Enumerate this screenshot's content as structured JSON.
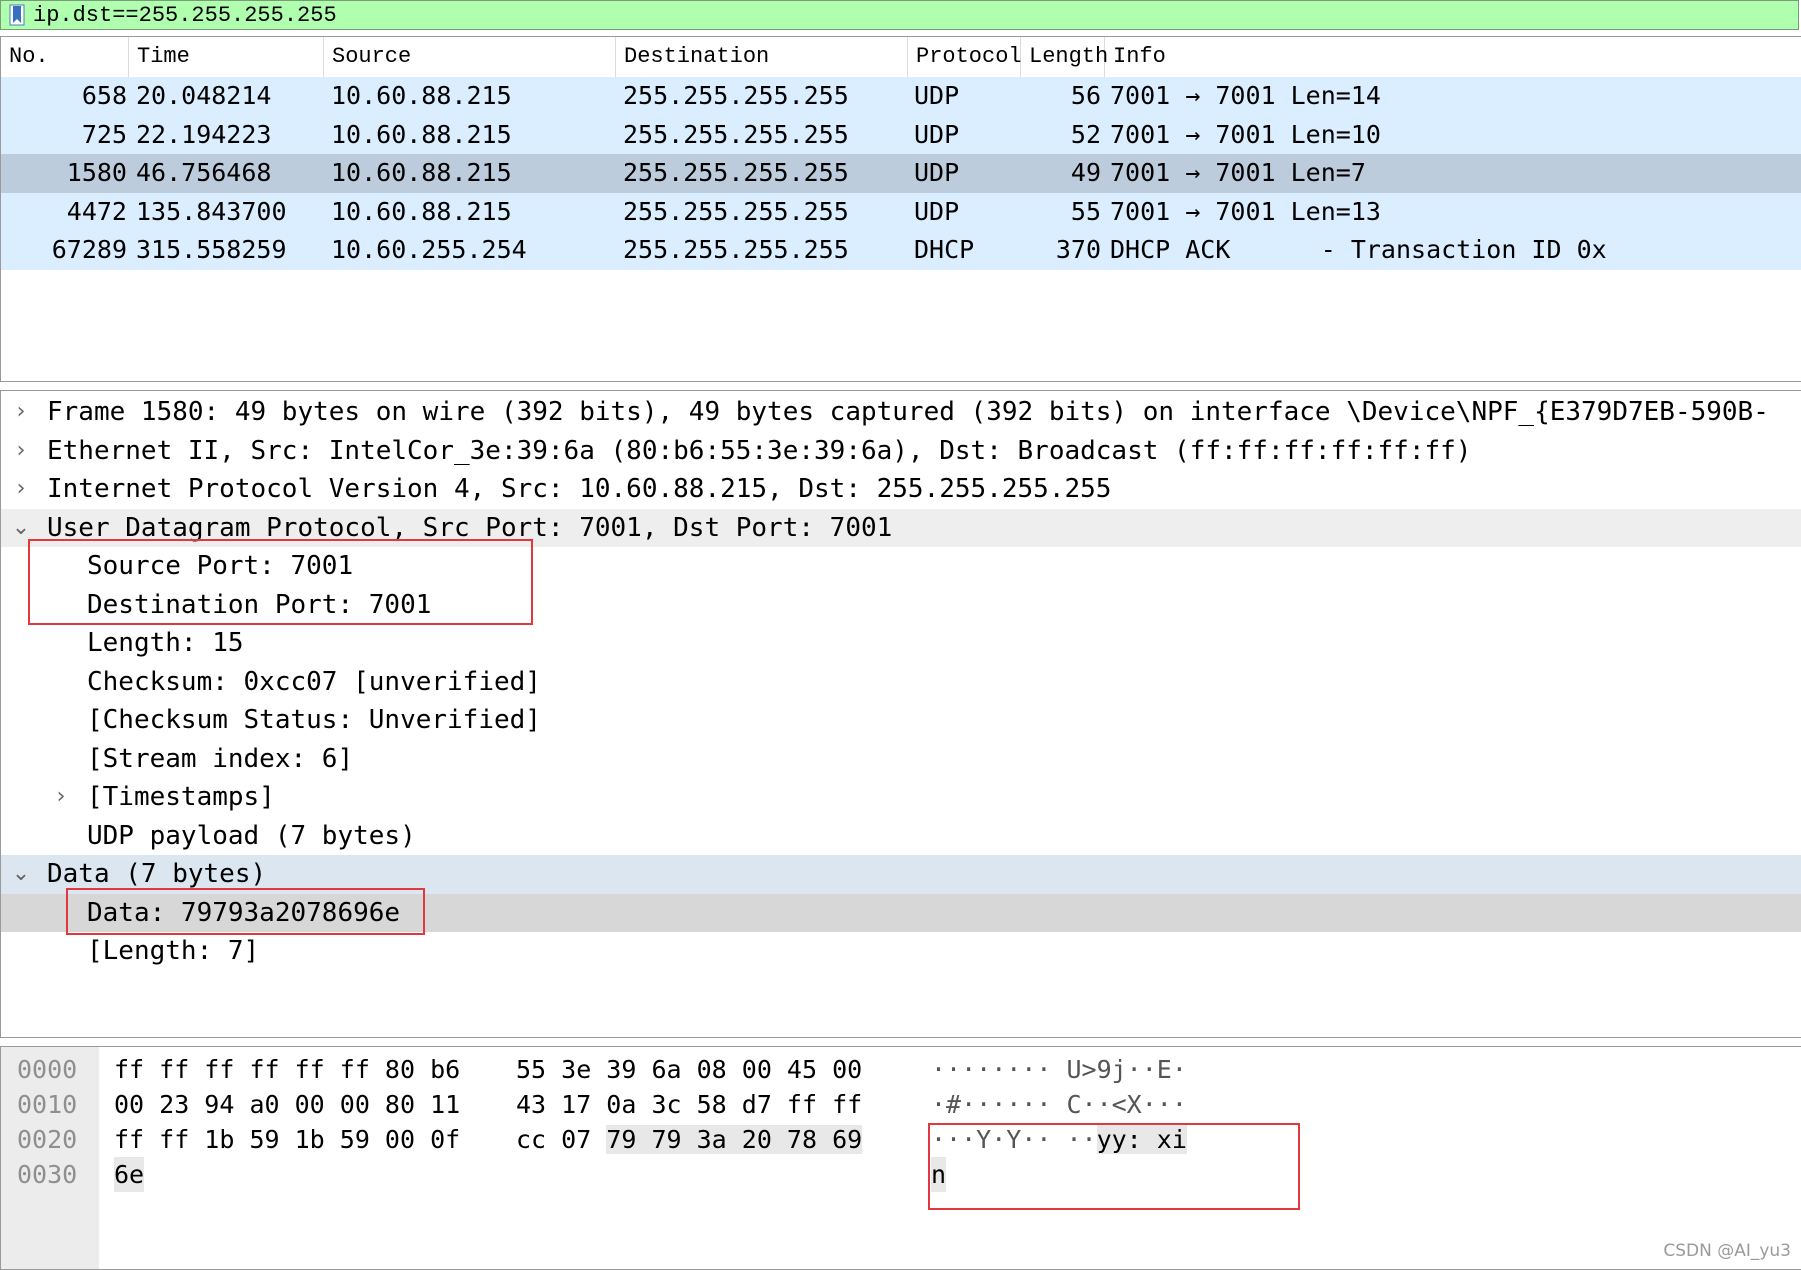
{
  "filter": {
    "text": "ip.dst==255.255.255.255"
  },
  "packet_list": {
    "columns": [
      "No.",
      "Time",
      "Source",
      "Destination",
      "Protocol",
      "Length",
      "Info"
    ],
    "rows": [
      {
        "no": "658",
        "time": "20.048214",
        "source": "10.60.88.215",
        "destination": "255.255.255.255",
        "protocol": "UDP",
        "length": "56",
        "info": "7001 → 7001 Len=14"
      },
      {
        "no": "725",
        "time": "22.194223",
        "source": "10.60.88.215",
        "destination": "255.255.255.255",
        "protocol": "UDP",
        "length": "52",
        "info": "7001 → 7001 Len=10"
      },
      {
        "no": "1580",
        "time": "46.756468",
        "source": "10.60.88.215",
        "destination": "255.255.255.255",
        "protocol": "UDP",
        "length": "49",
        "info": "7001 → 7001 Len=7"
      },
      {
        "no": "4472",
        "time": "135.843700",
        "source": "10.60.88.215",
        "destination": "255.255.255.255",
        "protocol": "UDP",
        "length": "55",
        "info": "7001 → 7001 Len=13"
      },
      {
        "no": "67289",
        "time": "315.558259",
        "source": "10.60.255.254",
        "destination": "255.255.255.255",
        "protocol": "DHCP",
        "length": "370",
        "info": "DHCP ACK      - Transaction ID 0x"
      }
    ],
    "selected_row": 2
  },
  "details": [
    {
      "text": "Frame 1580: 49 bytes on wire (392 bits), 49 bytes captured (392 bits) on interface \\Device\\NPF_{E379D7EB-590B-",
      "arrow": "right"
    },
    {
      "text": "Ethernet II, Src: IntelCor_3e:39:6a (80:b6:55:3e:39:6a), Dst: Broadcast (ff:ff:ff:ff:ff:ff)",
      "arrow": "right"
    },
    {
      "text": "Internet Protocol Version 4, Src: 10.60.88.215, Dst: 255.255.255.255",
      "arrow": "right"
    },
    {
      "text": "User Datagram Protocol, Src Port: 7001, Dst Port: 7001",
      "arrow": "down"
    },
    {
      "text": "Source Port: 7001"
    },
    {
      "text": "Destination Port: 7001"
    },
    {
      "text": "Length: 15"
    },
    {
      "text": "Checksum: 0xcc07 [unverified]"
    },
    {
      "text": "[Checksum Status: Unverified]"
    },
    {
      "text": "[Stream index: 6]"
    },
    {
      "text": "[Timestamps]",
      "arrow": "right"
    },
    {
      "text": "UDP payload (7 bytes)"
    },
    {
      "text": "Data (7 bytes)",
      "arrow": "down"
    },
    {
      "text": "Data: 79793a2078696e"
    },
    {
      "text": "[Length: 7]"
    }
  ],
  "bytes": [
    {
      "offset": "0000",
      "hex1": "ff ff ff ff ff ff 80 b6",
      "hex2": "55 3e 39 6a 08 00 45 00",
      "ascii": "········ U>9j··E·"
    },
    {
      "offset": "0010",
      "hex1": "00 23 94 a0 00 00 80 11",
      "hex2": "43 17 0a 3c 58 d7 ff ff",
      "ascii": "·#······ C··<X···"
    },
    {
      "offset": "0020",
      "hex1": "ff ff 1b 59 1b 59 00 0f",
      "hex2_plain": "cc 07 ",
      "hex2_hl": "79 79 3a 20 78 69",
      "ascii_plain": "···Y·Y·· ··",
      "ascii_hl": "yy: xi"
    },
    {
      "offset": "0030",
      "hex1": "6e",
      "hex2": "",
      "ascii": "n"
    }
  ],
  "watermark": "CSDN @AI_yu3",
  "colors": {
    "filter_bg": "#afffaf",
    "row_bg": "#dbeeff",
    "row_selected": "#bcccdc",
    "highlight_box": "#e0383e"
  }
}
